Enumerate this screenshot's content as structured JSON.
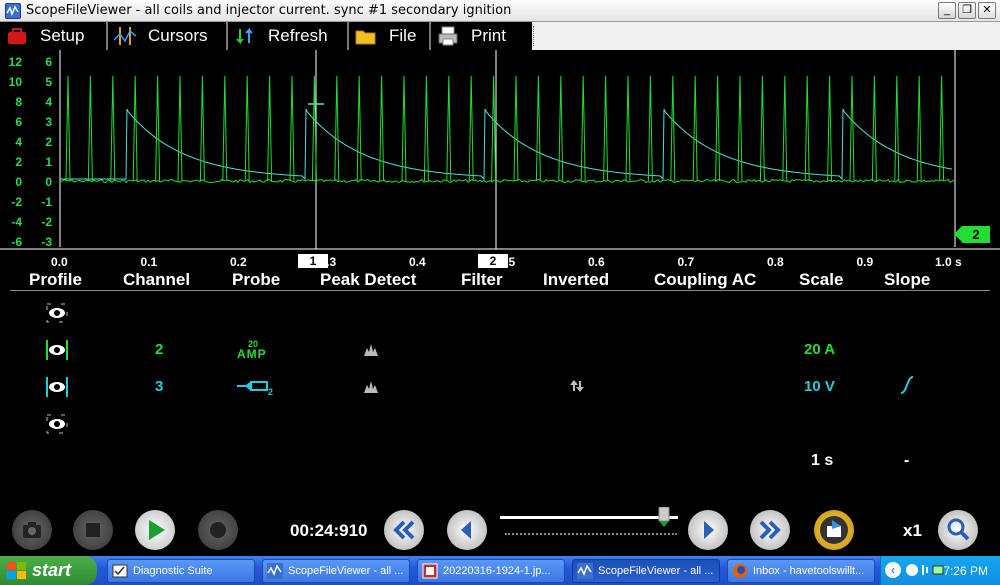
{
  "window": {
    "title": "ScopeFileViewer - all coils and injector current. sync #1 secondary ignition"
  },
  "toolbar": {
    "setup": "Setup",
    "cursors": "Cursors",
    "refresh": "Refresh",
    "file": "File",
    "print": "Print"
  },
  "scope": {
    "y_axis_outer": [
      "12",
      "10",
      "8",
      "6",
      "4",
      "2",
      "0",
      "-2",
      "-4",
      "-6"
    ],
    "y_axis_inner": [
      "6",
      "5",
      "4",
      "3",
      "2",
      "1",
      "0",
      "-1",
      "-2",
      "-3"
    ],
    "x_ticks": [
      "0.0",
      "0.1",
      "0.2",
      "0.3",
      "0.4",
      "0.5",
      "0.6",
      "0.7",
      "0.8",
      "0.9",
      "1.0 s"
    ],
    "cursor1": "1",
    "cursor2": "2",
    "channel_marker": "2",
    "colors": {
      "ch2": "#22dd33",
      "ch3": "#55dddd"
    }
  },
  "table": {
    "headers": {
      "profile": "Profile",
      "channel": "Channel",
      "probe": "Probe",
      "peak_detect": "Peak Detect",
      "filter": "Filter",
      "inverted": "Inverted",
      "coupling": "Coupling AC",
      "scale": "Scale",
      "slope": "Slope"
    },
    "rows": [
      {
        "channel": "",
        "probe": "",
        "scale": ""
      },
      {
        "channel": "2",
        "probe": "AMP",
        "probe_value": "20",
        "scale": "20 A"
      },
      {
        "channel": "3",
        "probe": "",
        "scale": "10 V"
      },
      {
        "channel": "",
        "probe": "",
        "scale": ""
      }
    ],
    "timebase": "1 s",
    "trigger_slope": "-"
  },
  "playback": {
    "time": "00:24:910",
    "zoom": "x1",
    "position": 0.92
  },
  "taskbar": {
    "start": "start",
    "tasks": [
      {
        "label": "Diagnostic Suite",
        "icon": "window-icon"
      },
      {
        "label": "ScopeFileViewer - all ...",
        "icon": "scope-icon"
      },
      {
        "label": "20220316-1924-1.jp...",
        "icon": "image-icon"
      },
      {
        "label": "ScopeFileViewer - all ...",
        "icon": "scope-icon",
        "active": true
      },
      {
        "label": "Inbox - havetoolswillt...",
        "icon": "firefox-icon"
      }
    ],
    "clock": "7:26 PM"
  }
}
